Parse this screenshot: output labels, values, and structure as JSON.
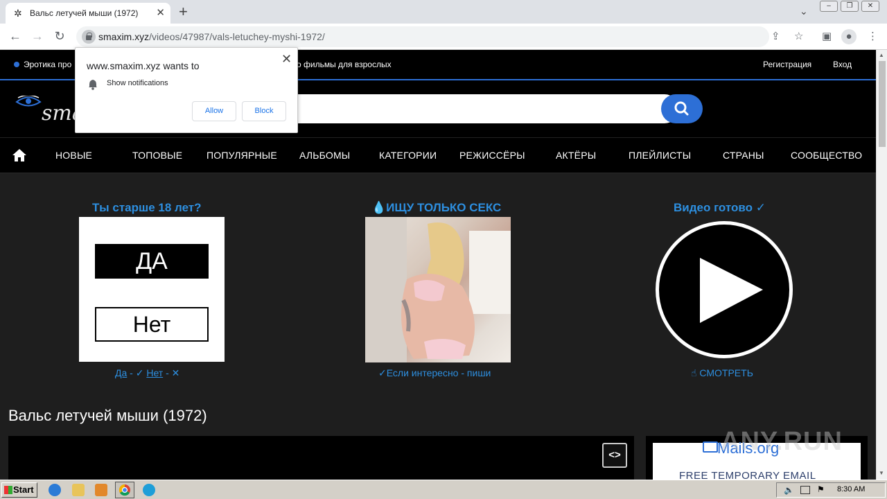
{
  "browser": {
    "tab_title": "Вальс летучей мыши (1972)",
    "tab_close": "✕",
    "new_tab": "+",
    "url_host": "smaxim.xyz",
    "url_path": "/videos/47987/vals-letuchey-myshi-1972/"
  },
  "site": {
    "top_tagline_left": "Эротика про",
    "top_tagline_right": "о фильмы для взрослых",
    "register": "Регистрация",
    "login": "Вход",
    "logo_text": "sma",
    "accent_color": "#2d6fd6"
  },
  "menu": {
    "items": [
      "НОВЫЕ",
      "ТОПОВЫЕ",
      "ПОПУЛЯРНЫЕ",
      "АЛЬБОМЫ",
      "КАТЕГОРИИ",
      "РЕЖИССЁРЫ",
      "АКТЁРЫ",
      "ПЛЕЙЛИСТЫ",
      "СТРАНЫ",
      "СООБЩЕСТВО"
    ]
  },
  "promo": {
    "age_title": "Ты старше 18 лет?",
    "yes_label": "ДА",
    "no_label": "Нет",
    "age_caption_yes": "Да",
    "age_caption_sep1": " - ✓ ",
    "age_caption_no": "Нет",
    "age_caption_sep2": " - ✕",
    "mid_title": "💧ИЩУ ТОЛЬКО СЕКС",
    "mid_caption": "✓Если интересно - пиши",
    "video_title": "Видео готово ✓",
    "video_caption": "☝ СМОТРЕТЬ"
  },
  "page": {
    "heading": "Вальс летучей мыши (1972)",
    "embed_label": "<>",
    "ad_brand": "Mails.org",
    "ad_text": "FREE TEMPORARY EMAIL"
  },
  "watermark": "ANY.RUN",
  "popup": {
    "title": "www.smaxim.xyz wants to",
    "message": "Show notifications",
    "allow": "Allow",
    "block": "Block",
    "close": "✕"
  },
  "taskbar": {
    "start": "Start",
    "clock": "8:30 AM"
  }
}
